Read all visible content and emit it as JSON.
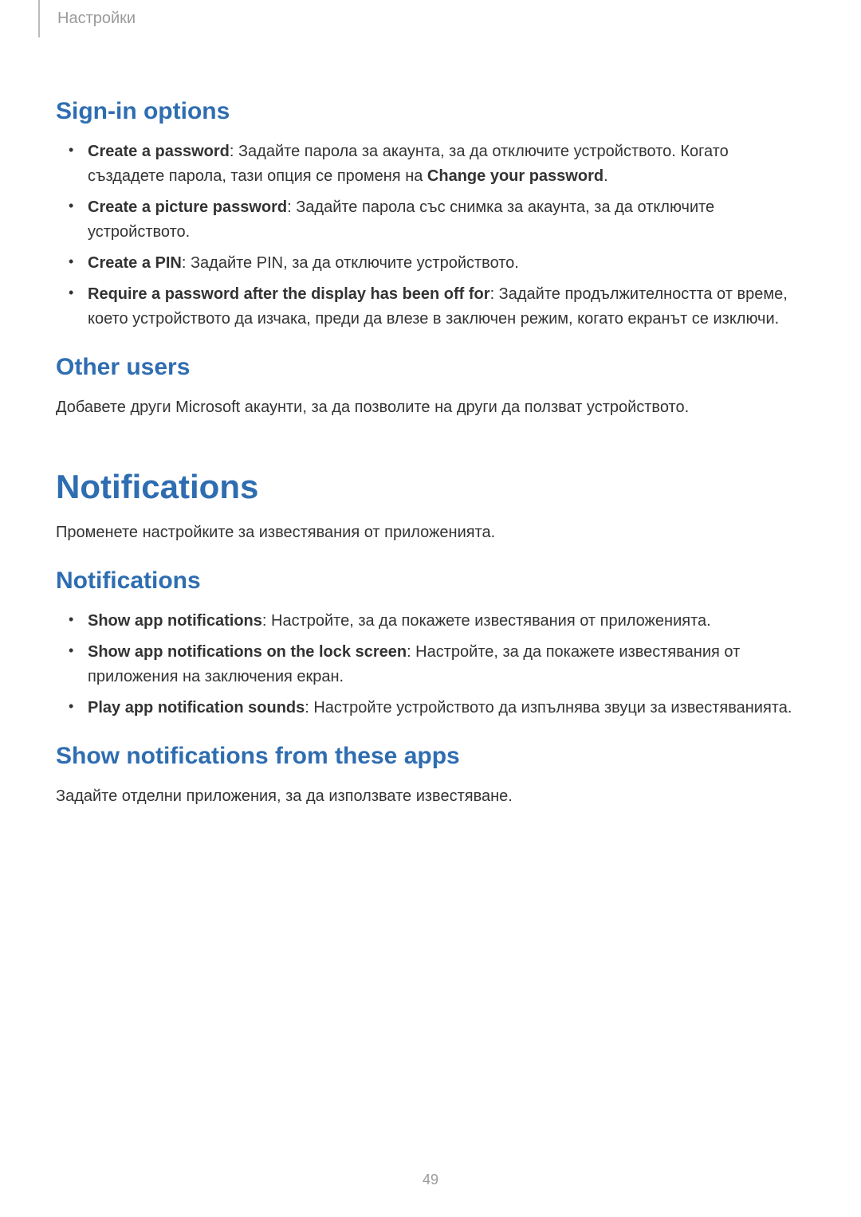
{
  "header": {
    "breadcrumb": "Настройки"
  },
  "sign_in": {
    "heading": "Sign-in options",
    "items": [
      {
        "bold": "Create a password",
        "text": ": Задайте парола за акаунта, за да отключите устройството. Когато създадете парола, тази опция се променя на ",
        "bold2": "Change your password",
        "tail": "."
      },
      {
        "bold": "Create a picture password",
        "text": ": Задайте парола със снимка за акаунта, за да отключите устройството."
      },
      {
        "bold": "Create a PIN",
        "text": ": Задайте PIN, за да отключите устройството."
      },
      {
        "bold": "Require a password after the display has been off for",
        "text": ": Задайте продължителността от време, което устройството да изчака, преди да влезе в заключен режим, когато екранът се изключи."
      }
    ]
  },
  "other_users": {
    "heading": "Other users",
    "para": "Добавете други Microsoft акаунти, за да позволите на други да ползват устройството."
  },
  "notifications_main": {
    "heading": "Notifications",
    "para": "Променете настройките за известявания от приложенията."
  },
  "notifications_sub": {
    "heading": "Notifications",
    "items": [
      {
        "bold": "Show app notifications",
        "text": ": Настройте, за да покажете известявания от приложенията."
      },
      {
        "bold": "Show app notifications on the lock screen",
        "text": ": Настройте, за да покажете известявания от приложения на заключения екран."
      },
      {
        "bold": "Play app notification sounds",
        "text": ": Настройте устройството да изпълнява звуци за известяванията."
      }
    ]
  },
  "show_from_apps": {
    "heading": "Show notifications from these apps",
    "para": "Задайте отделни приложения, за да използвате известяване."
  },
  "page_number": "49"
}
